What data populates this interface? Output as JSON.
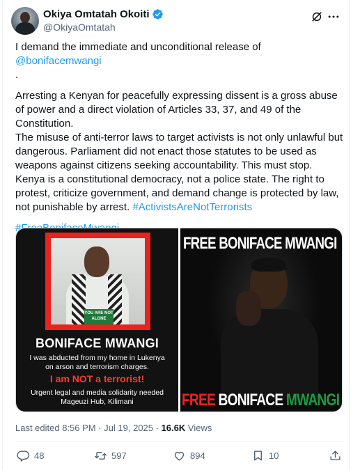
{
  "author": {
    "name": "Okiya Omtatah Okoiti",
    "handle": "@OkiyaOmtatah"
  },
  "tweet": {
    "p1_text": "I demand the immediate and unconditional release of ",
    "p1_mention": "@bonifacemwangi",
    "p1_end": ".",
    "p2": "Arresting a Kenyan for peacefully expressing dissent is a gross abuse of power and a direct violation of Articles 33, 37, and 49 of the Constitution.",
    "p3_text": "The misuse of anti-terror laws to target activists is not only unlawful but dangerous. Parliament did not enact those statutes to be used as weapons against citizens seeking accountability. This must stop. Kenya is a constitutional democracy, not a police state. The right to protest, criticize government, and demand change is protected by law, not punishable by arrest. ",
    "p3_hashtag": "#ActivistsAreNotTerrorists",
    "hashtag2": "#FreeBonifaceMwangi"
  },
  "media": {
    "left": {
      "sign_text": "YOU ARE NOT ALONE",
      "name": "BONIFACE MWANGI",
      "line1": "I was abducted from my home in Lukenya",
      "line2": "on arson and terrorism charges.",
      "terror": "I am NOT a terrorist!",
      "line3": "Urgent legal and media solidarity needed",
      "line4": "Mageuzi Hub, Kilimani"
    },
    "right": {
      "top_text": "FREE BONIFACE MWANGI",
      "bottom_w1": "FREE ",
      "bottom_w2": "BONIFACE ",
      "bottom_w3": "MWANGI"
    }
  },
  "meta": {
    "edited": "Last edited 8:56 PM · Jul 19, 2025 · ",
    "views_count": "16.6K",
    "views_label": " Views"
  },
  "actions": {
    "replies": "48",
    "reposts": "597",
    "likes": "894",
    "bookmarks": "10"
  },
  "colors": {
    "link": "#1d9bf0",
    "verified": "#1d9bf0",
    "poster_red": "#e8231f",
    "kenya_green": "#1e9b3f"
  }
}
